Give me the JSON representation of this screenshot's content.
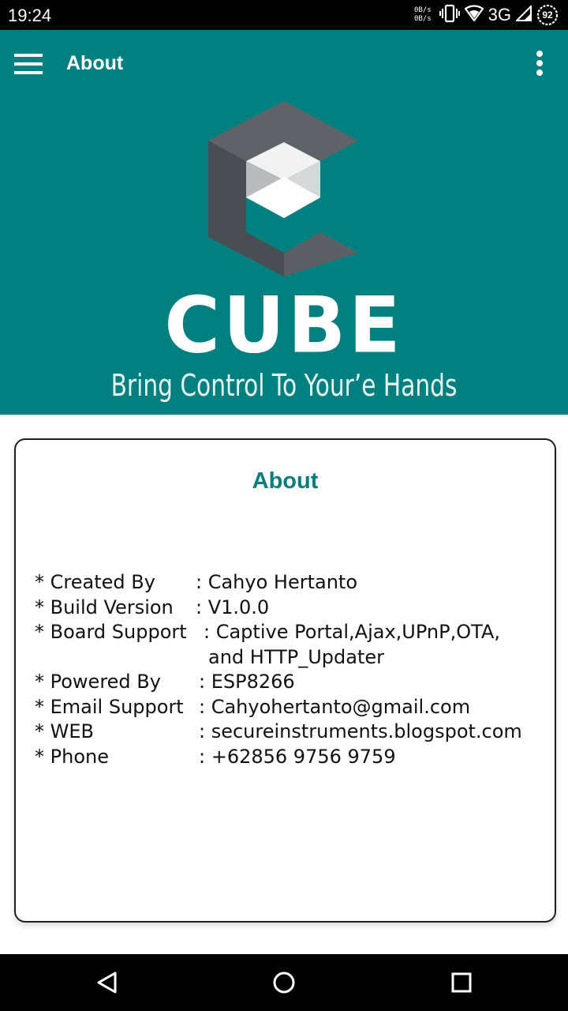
{
  "status_bar": {
    "time": "19:24",
    "net_up": "0B/s",
    "net_down": "0B/s",
    "network_type": "3G",
    "battery_level": "92",
    "icons": [
      "vibrate-icon",
      "wifi-icon",
      "signal-icon",
      "battery-icon"
    ]
  },
  "toolbar": {
    "title": "About",
    "menu_icon": "hamburger-menu-icon",
    "overflow_icon": "more-vertical-icon"
  },
  "header": {
    "brand_name": "CUBE",
    "tagline": "Bring Control To Your’e Hands",
    "background_color": "#01807f"
  },
  "card": {
    "title": "About",
    "title_color": "#0a7c7b",
    "rows": [
      {
        "label": "* Created By",
        "value": ": Cahyo Hertanto"
      },
      {
        "label": "* Build Version",
        "value": ": V1.0.0"
      },
      {
        "label": "* Board Support",
        "value": ": Captive Portal,Ajax,UPnP,OTA,"
      },
      {
        "label": "",
        "value": "and HTTP_Updater"
      },
      {
        "label": "* Powered By",
        "value": ": ESP8266"
      },
      {
        "label": "* Email Support",
        "value": ": Cahyohertanto@gmail.com"
      },
      {
        "label": "* WEB",
        "value": ": secureinstruments.blogspot.com"
      },
      {
        "label": "* Phone",
        "value": ": +62856 9756 9759"
      }
    ]
  },
  "nav_bar": {
    "buttons": [
      "back-icon",
      "home-icon",
      "recents-icon"
    ]
  }
}
